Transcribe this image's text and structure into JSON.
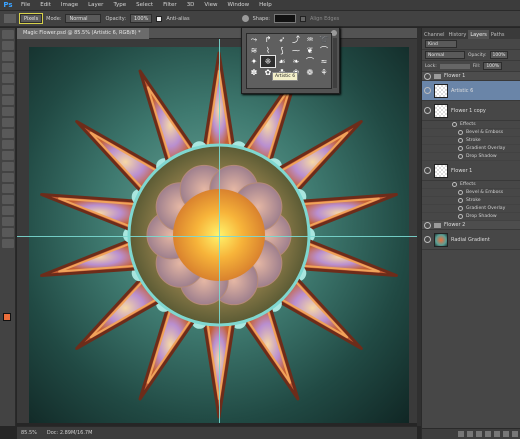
{
  "menubar": {
    "logo": "Ps",
    "items": [
      "File",
      "Edit",
      "Image",
      "Layer",
      "Type",
      "Select",
      "Filter",
      "3D",
      "View",
      "Window",
      "Help"
    ]
  },
  "options": {
    "mode_select": "Pixels",
    "mode_label": "Mode:",
    "mode_value": "Normal",
    "opacity_label": "Opacity:",
    "opacity_value": "100%",
    "antialias_label": "Anti-alias",
    "shape_label": "Shape:",
    "align_label": "Align Edges"
  },
  "document": {
    "tab_title": "Magic Flower.psd @ 85.5% (Artistic 6, RGB/8) *"
  },
  "colors": {
    "foreground": "#ec6e3b",
    "hex_label": "#ec6e3b",
    "accent": "#7bd9d1"
  },
  "shape_picker": {
    "tooltip": "Artistic 6",
    "shapes": [
      "⤳",
      "↱",
      "➶",
      "⤴",
      "♒",
      "➰",
      "≋",
      "⌇",
      "⟆",
      "⁓",
      "❦",
      "⌒",
      "✦",
      "❈",
      "☙",
      "❧",
      "⌒",
      "≈",
      "✽",
      "✿",
      "☘",
      "❀",
      "❁",
      "⚘"
    ]
  },
  "panel": {
    "tabs": [
      "Channel",
      "History",
      "Layers",
      "Paths"
    ],
    "active_tab": "Layers",
    "kind_select": "Kind",
    "blend_select": "Normal",
    "opacity_label": "Opacity:",
    "opacity_value": "100%",
    "lock_label": "Lock:",
    "fill_label": "Fill:",
    "fill_value": "100%"
  },
  "layers": {
    "group1": "Flower 1",
    "artistic": "Artistic 6",
    "flower_copy": "Flower 1 copy",
    "effects_label": "Effects",
    "copy_effects": [
      "Bevel & Emboss",
      "Stroke",
      "Gradient Overlay",
      "Drop Shadow"
    ],
    "flower1": "Flower 1",
    "f1_effects": [
      "Bevel & Emboss",
      "Stroke",
      "Gradient Overlay",
      "Drop Shadow"
    ],
    "group2": "Flower 2",
    "radial": "Radial Gradient"
  },
  "status": {
    "zoom": "85.5%",
    "doc": "Doc: 2.89M/16.7M"
  }
}
